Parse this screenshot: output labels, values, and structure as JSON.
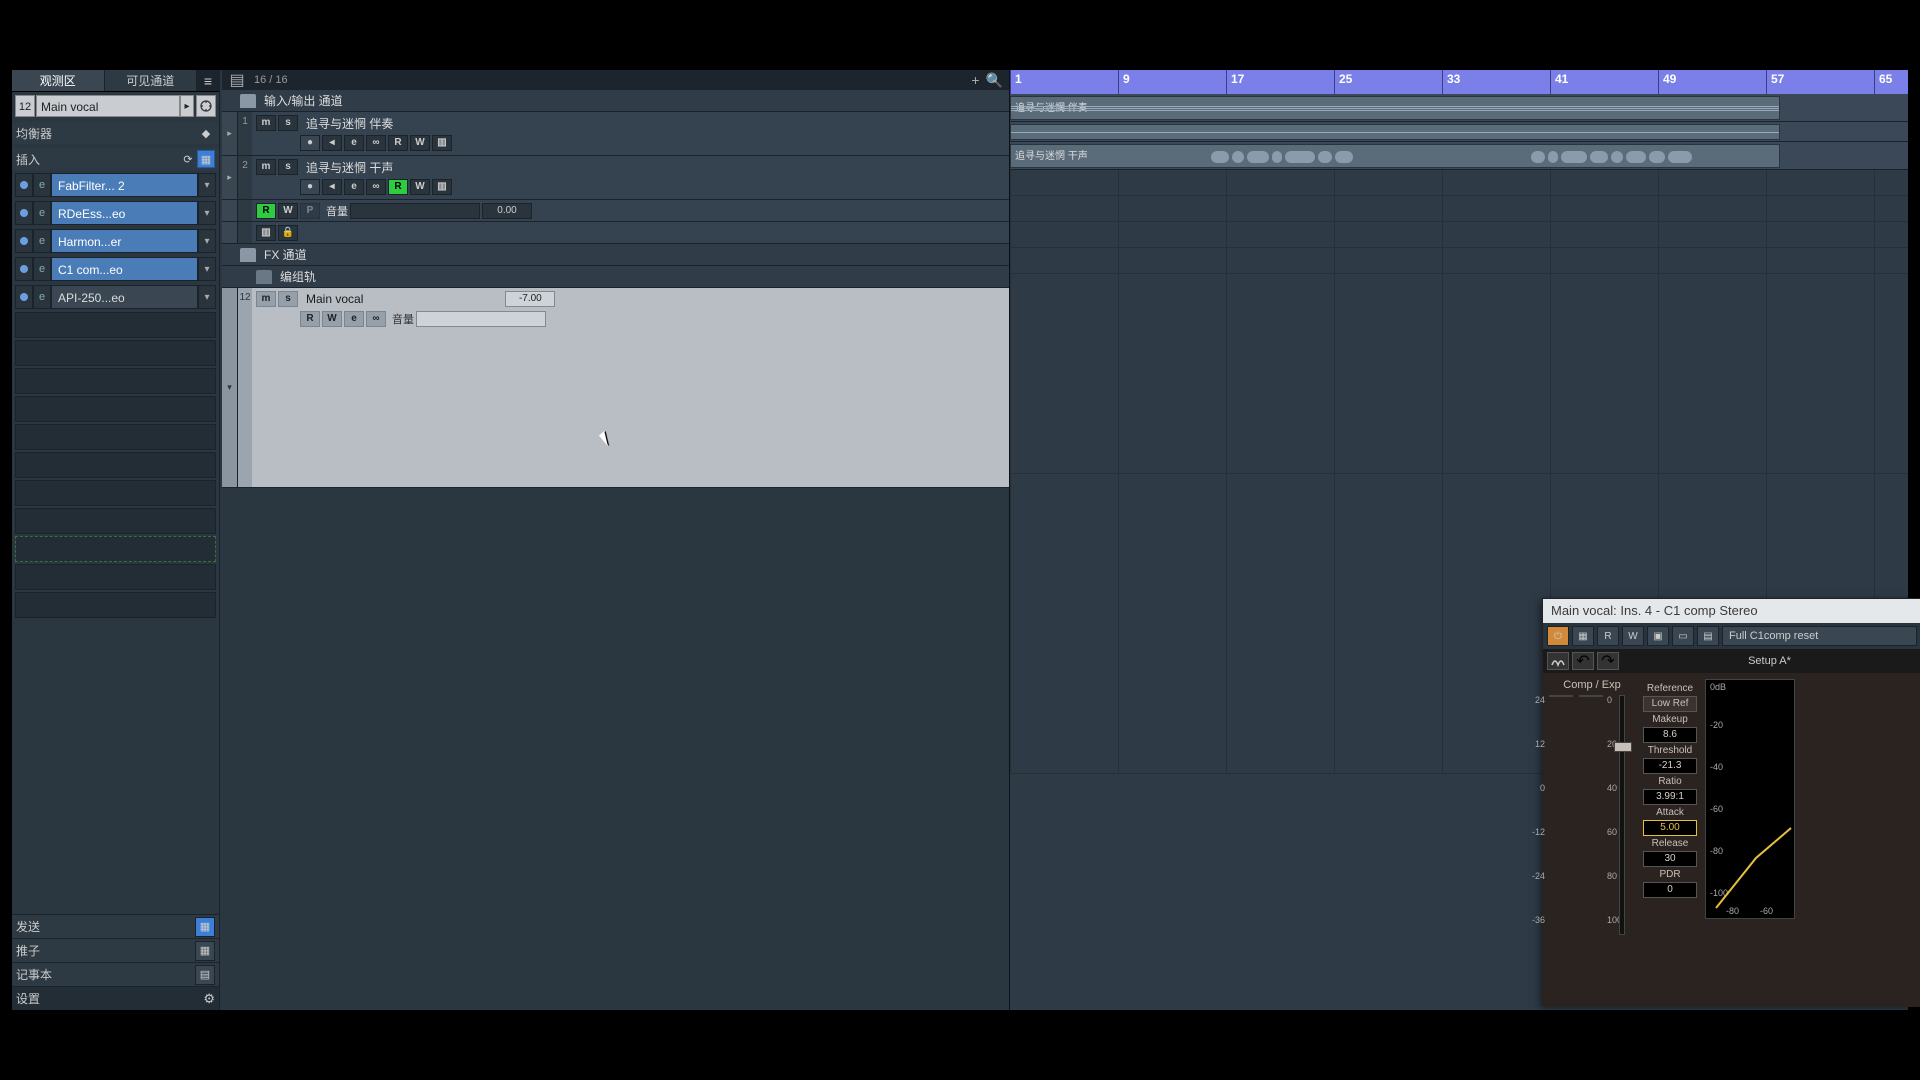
{
  "inspector": {
    "tabs": [
      "观测区",
      "可见通道"
    ],
    "activeTab": 0,
    "channelNum": "12",
    "channelName": "Main vocal",
    "eqLabel": "均衡器",
    "insertLabel": "插入",
    "inserts": [
      {
        "name": "FabFilter... 2",
        "style": "blue"
      },
      {
        "name": "RDeEss...eo",
        "style": "blue"
      },
      {
        "name": "Harmon...er",
        "style": "blue"
      },
      {
        "name": "C1 com...eo",
        "style": "blue"
      },
      {
        "name": "API-250...eo",
        "style": "gray"
      }
    ],
    "sendLabel": "发送",
    "faderLabel": "推子",
    "noteLabel": "记事本",
    "settingsLabel": "设置"
  },
  "tracklist": {
    "counter": "16 / 16",
    "folder1": "输入/输出 通道",
    "folder2": "FX 通道",
    "folder3": "编组轨",
    "tracks": [
      {
        "num": "1",
        "name": "追寻与迷惘 伴奏",
        "val": ""
      },
      {
        "num": "2",
        "name": "追寻与迷惘 干声",
        "val": ""
      }
    ],
    "autoRow": {
      "name": "音量",
      "val": "0.00"
    },
    "selTrack": {
      "num": "12",
      "name": "Main vocal",
      "val": "-7.00",
      "autoName": "音量"
    }
  },
  "ruler": {
    "marks": [
      "1",
      "9",
      "17",
      "25",
      "33",
      "41",
      "49",
      "57",
      "65"
    ]
  },
  "waveClips": [
    {
      "label": "追寻与迷惘 伴奏"
    },
    {
      "label": "追寻与迷惘 干声"
    }
  ],
  "plugin": {
    "title": "Main vocal: Ins. 4 - C1 comp Stereo",
    "preset": "Full C1comp reset",
    "setup": "Setup A*",
    "sectionLabel": "Comp / Exp",
    "leftTicks": [
      "24",
      "12",
      "0",
      "-12",
      "-24",
      "-36"
    ],
    "rightTicks": [
      "0",
      "20",
      "40",
      "60",
      "80",
      "100"
    ],
    "params": [
      {
        "label": "Reference",
        "val": "Low Ref",
        "type": "btn"
      },
      {
        "label": "Makeup",
        "val": "8.6",
        "type": "val"
      },
      {
        "label": "Threshold",
        "val": "-21.3",
        "type": "val"
      },
      {
        "label": "Ratio",
        "val": "3.99:1",
        "type": "val"
      },
      {
        "label": "Attack",
        "val": "5.00",
        "type": "yellow"
      },
      {
        "label": "Release",
        "val": "30",
        "type": "val"
      },
      {
        "label": "PDR",
        "val": "0",
        "type": "val"
      }
    ],
    "curveTicks": {
      "top": "0dB",
      "mids": [
        "-20",
        "-40",
        "-60",
        "-80",
        "-100"
      ],
      "bots": [
        "-80",
        "-60"
      ]
    }
  }
}
